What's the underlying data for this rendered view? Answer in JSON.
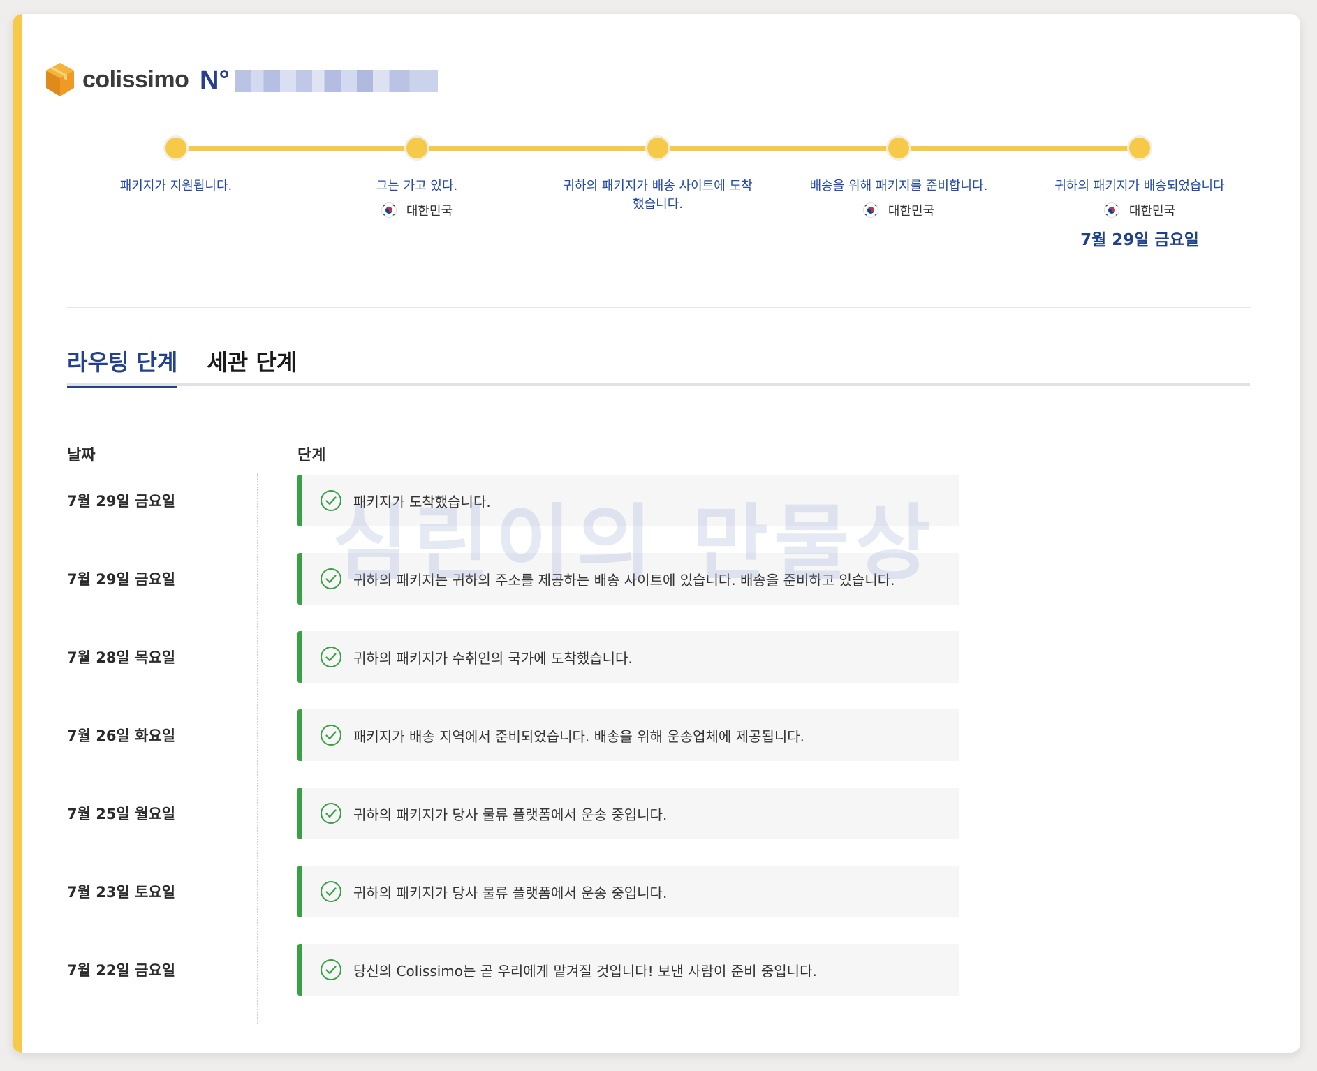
{
  "header": {
    "brand_name": "colissimo",
    "tracking_prefix": "N°"
  },
  "progress": {
    "steps": [
      {
        "label": "패키지가 지원됩니다.",
        "country": "",
        "date": ""
      },
      {
        "label": "그는 가고 있다.",
        "country": "대한민국",
        "date": ""
      },
      {
        "label": "귀하의 패키지가 배송 사이트에 도착했습니다.",
        "country": "",
        "date": ""
      },
      {
        "label": "배송을 위해 패키지를 준비합니다.",
        "country": "대한민국",
        "date": ""
      },
      {
        "label": "귀하의 패키지가 배송되었습니다",
        "country": "대한민국",
        "date": "7월 29일 금요일"
      }
    ],
    "completed_fraction": 1.0
  },
  "tabs": [
    {
      "label": "라우팅 단계",
      "active": true
    },
    {
      "label": "세관 단계",
      "active": false
    }
  ],
  "table": {
    "headers": {
      "date": "날짜",
      "step": "단계"
    },
    "rows": [
      {
        "date": "7월 29일 금요일",
        "event": "패키지가 도착했습니다."
      },
      {
        "date": "7월 29일 금요일",
        "event": "귀하의 패키지는 귀하의 주소를 제공하는 배송 사이트에 있습니다. 배송을 준비하고 있습니다."
      },
      {
        "date": "7월 28일 목요일",
        "event": "귀하의 패키지가 수취인의 국가에 도착했습니다."
      },
      {
        "date": "7월 26일 화요일",
        "event": "패키지가 배송 지역에서 준비되었습니다. 배송을 위해 운송업체에 제공됩니다."
      },
      {
        "date": "7월 25일 월요일",
        "event": "귀하의 패키지가 당사 물류 플랫폼에서 운송 중입니다."
      },
      {
        "date": "7월 23일 토요일",
        "event": "귀하의 패키지가 당사 물류 플랫폼에서 운송 중입니다."
      },
      {
        "date": "7월 22일 금요일",
        "event": "당신의 Colissimo는 곧 우리에게 맡겨질 것입니다! 보낸 사람이 준비 중입니다."
      }
    ]
  },
  "watermark": "심린이의 만물상",
  "colors": {
    "accent_yellow": "#f7c948",
    "brand_blue": "#24418f",
    "status_green": "#3aa046"
  },
  "icons": [
    "colissimo-box-icon",
    "korea-flag-icon",
    "check-circle-icon"
  ]
}
